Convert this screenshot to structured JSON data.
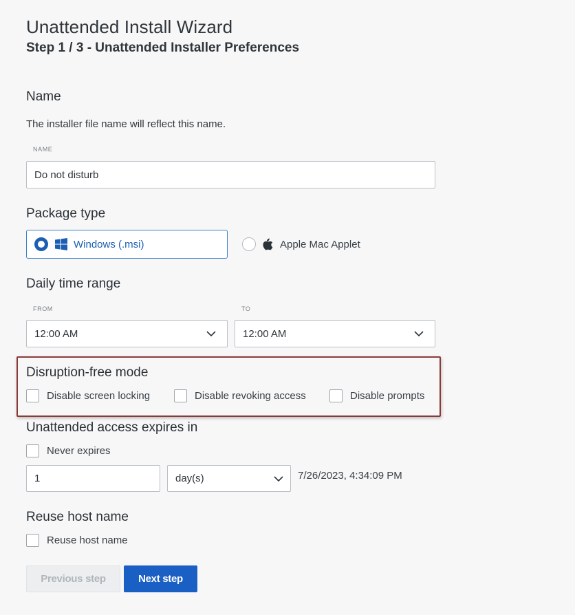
{
  "header": {
    "title": "Unattended Install Wizard",
    "subtitle": "Step 1 / 3 - Unattended Installer Preferences"
  },
  "name_section": {
    "heading": "Name",
    "description": "The installer file name will reflect this name.",
    "field_label": "NAME",
    "field_value": "Do not disturb"
  },
  "package_section": {
    "heading": "Package type",
    "options": [
      {
        "label": "Windows (.msi)",
        "selected": true,
        "icon": "windows-icon"
      },
      {
        "label": "Apple Mac Applet",
        "selected": false,
        "icon": "apple-icon"
      }
    ]
  },
  "time_section": {
    "heading": "Daily time range",
    "from_label": "FROM",
    "from_value": "12:00 AM",
    "to_label": "TO",
    "to_value": "12:00 AM"
  },
  "disruption_section": {
    "heading": "Disruption-free mode",
    "options": [
      {
        "label": "Disable screen locking",
        "checked": false
      },
      {
        "label": "Disable revoking access",
        "checked": false
      },
      {
        "label": "Disable prompts",
        "checked": false
      }
    ]
  },
  "expiry_section": {
    "heading": "Unattended access expires in",
    "never_label": "Never expires",
    "amount_value": "1",
    "unit_value": "day(s)",
    "expiry_datetime": "7/26/2023, 4:34:09 PM"
  },
  "reuse_section": {
    "heading": "Reuse host name",
    "checkbox_label": "Reuse host name"
  },
  "footer": {
    "previous_label": "Previous step",
    "next_label": "Next step"
  },
  "colors": {
    "accent": "#1a5fc4",
    "highlight_border": "#8b3a3a"
  }
}
